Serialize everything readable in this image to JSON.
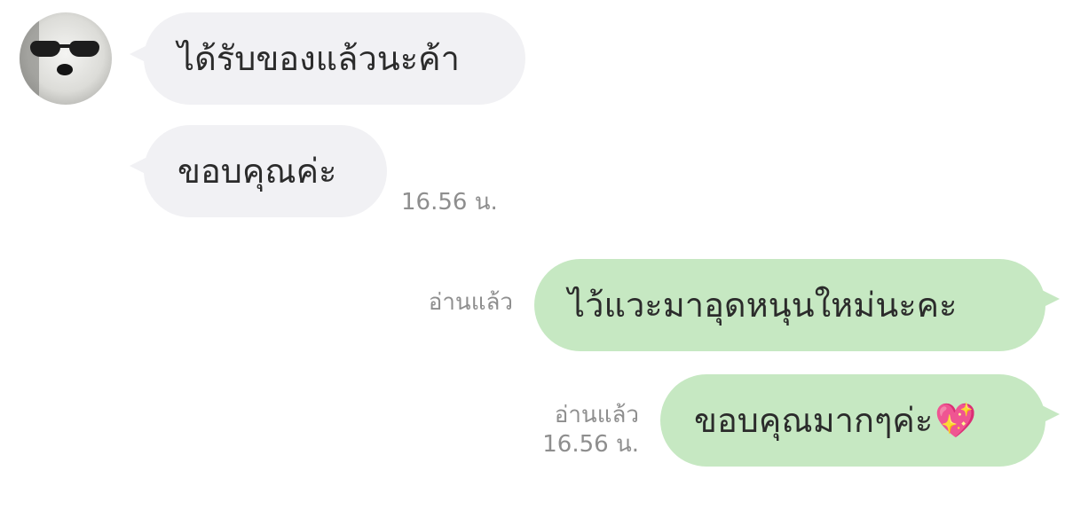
{
  "contact": {
    "avatar_icon": "dog-with-sunglasses-avatar"
  },
  "messages": [
    {
      "direction": "incoming",
      "text": "ได้รับของแล้วนะค้า"
    },
    {
      "direction": "incoming",
      "text": "ขอบคุณค่ะ",
      "time": "16.56 น."
    },
    {
      "direction": "outgoing",
      "text": "ไว้แวะมาอุดหนุนใหม่นะคะ",
      "read": "อ่านแล้ว"
    },
    {
      "direction": "outgoing",
      "text": "ขอบคุณมากๆค่ะ",
      "emoji": "💖",
      "read": "อ่านแล้ว",
      "time": "16.56 น."
    }
  ],
  "colors": {
    "incoming_bubble": "#f1f1f4",
    "outgoing_bubble": "#c6e8c2",
    "meta_text": "#8e8e8e"
  }
}
